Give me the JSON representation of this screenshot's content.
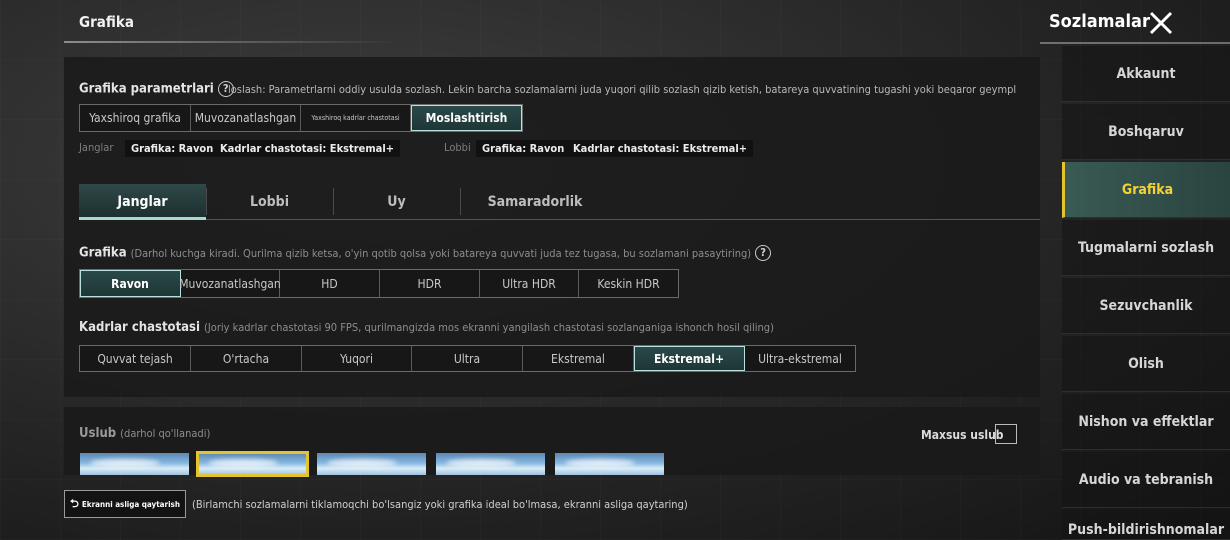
{
  "header": {
    "page_title": "Grafika",
    "settings_title": "Sozlamalar"
  },
  "graphics_presets": {
    "label": "Grafika parametrlari",
    "description": "loslash: Parametrlarni oddiy usulda sozlash. Lekin barcha sozlamalarni juda yuqori qilib sozlash qizib ketish, batareya quvvatining tugashi yoki beqaror geympl",
    "options": [
      "Yaxshiroq grafika",
      "Muvozanatlashgan",
      "Yaxshiroq kadrlar chastotasi",
      "Moslashtirish"
    ],
    "selected": "Moslashtirish",
    "battle_label": "Janglar",
    "battle_graphics": "Grafika: Ravon",
    "battle_fps": "Kadrlar chastotasi: Ekstremal+",
    "lobby_label": "Lobbi",
    "lobby_graphics": "Grafika: Ravon",
    "lobby_fps": "Kadrlar chastotasi: Ekstremal+"
  },
  "tabs": [
    "Janglar",
    "Lobbi",
    "Uy",
    "Samaradorlik"
  ],
  "active_tab": "Janglar",
  "graphics": {
    "label": "Grafika",
    "note": "(Darhol kuchga kiradi. Qurilma qizib ketsa, o'yin qotib qolsa yoki batareya quvvati juda tez tugasa, bu sozlamani pasaytiring)",
    "options": [
      "Ravon",
      "Muvozanatlashgan",
      "HD",
      "HDR",
      "Ultra HDR",
      "Keskin HDR"
    ],
    "selected": "Ravon"
  },
  "frame_rate": {
    "label": "Kadrlar chastotasi",
    "note": "(Joriy kadrlar chastotasi 90 FPS, qurilmangizda mos ekranni yangilash chastotasi sozlanganiga ishonch hosil qiling)",
    "options": [
      "Quvvat tejash",
      "O'rtacha",
      "Yuqori",
      "Ultra",
      "Ekstremal",
      "Ekstremal+",
      "Ultra-ekstremal"
    ],
    "selected": "Ekstremal+"
  },
  "style": {
    "label": "Uslub",
    "note": "(darhol qo'llanadi)",
    "custom_label": "Maxsus uslub",
    "selected_index": 1
  },
  "reset": {
    "button_label": "Ekranni asliga qaytarish",
    "note": "(Birlamchi sozlamalarni tiklamoqchi bo'lsangiz yoki grafika ideal bo'lmasa, ekranni asliga qaytaring)"
  },
  "sidebar": {
    "items": [
      "Akkaunt",
      "Boshqaruv",
      "Grafika",
      "Tugmalarni sozlash",
      "Sezuvchanlik",
      "Olish",
      "Nishon va effektlar",
      "Audio va tebranish",
      "Push-bildirishnomalar"
    ],
    "active": "Grafika"
  },
  "icons": {
    "close": "close-icon",
    "help": "help-icon",
    "reset": "reset-icon"
  },
  "colors": {
    "accent_teal": "#a8d8d2",
    "active_yellow": "#f4d234"
  }
}
